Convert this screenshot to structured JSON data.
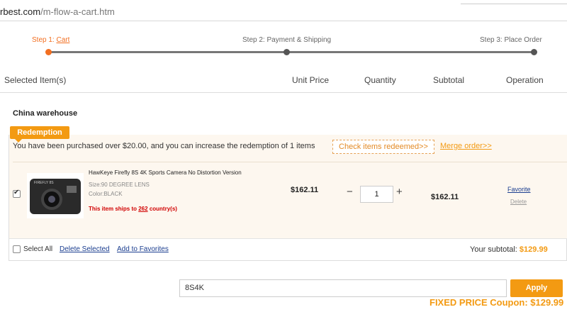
{
  "browser": {
    "url_host": "rbest.com",
    "url_path": "/m-flow-a-cart.htm"
  },
  "steps": [
    {
      "prefix": "Step 1: ",
      "label": "Cart",
      "active": true
    },
    {
      "label": "Step 2: Payment & Shipping",
      "active": false
    },
    {
      "label": "Step 3: Place Order",
      "active": false
    }
  ],
  "columns": {
    "selected_items": "Selected Item(s)",
    "unit_price": "Unit Price",
    "quantity": "Quantity",
    "subtotal": "Subtotal",
    "operation": "Operation"
  },
  "warehouse": "China warehouse",
  "promo": {
    "badge": "Redemption",
    "message": "You have been purchased over $20.00, and you can increase the redemption of 1 items",
    "check_button": "Check items redeemed>>",
    "merge_link": "Merge order>>"
  },
  "item": {
    "checked": true,
    "name": "HawKeye Firefly 8S 4K Sports Camera No Distortion Version",
    "size": "Size:90 DEGREE LENS",
    "color": "Color:BLACK",
    "ships_prefix": "This item ships to ",
    "ships_count": "262",
    "ships_suffix": " country(s)",
    "thumb_label": "FIREFLY 8S",
    "unit_price": "$162.11",
    "quantity": "1",
    "minus": "−",
    "plus": "+",
    "subtotal": "$162.11",
    "favorite": "Favorite",
    "delete": "Delete"
  },
  "footer": {
    "select_all": "Select All",
    "delete_selected": "Delete Selected",
    "add_to_favorites": "Add to Favorites",
    "subtotal_label": "Your subtotal: ",
    "subtotal_value": "$129.99"
  },
  "coupon": {
    "code": "8S4K",
    "apply": "Apply",
    "fixed_price": "FIXED PRICE Coupon: $129.99"
  },
  "colors": {
    "accent": "#f39a12",
    "step_active": "#f26f21",
    "link": "#1a3d8f",
    "warning": "#d10000"
  }
}
